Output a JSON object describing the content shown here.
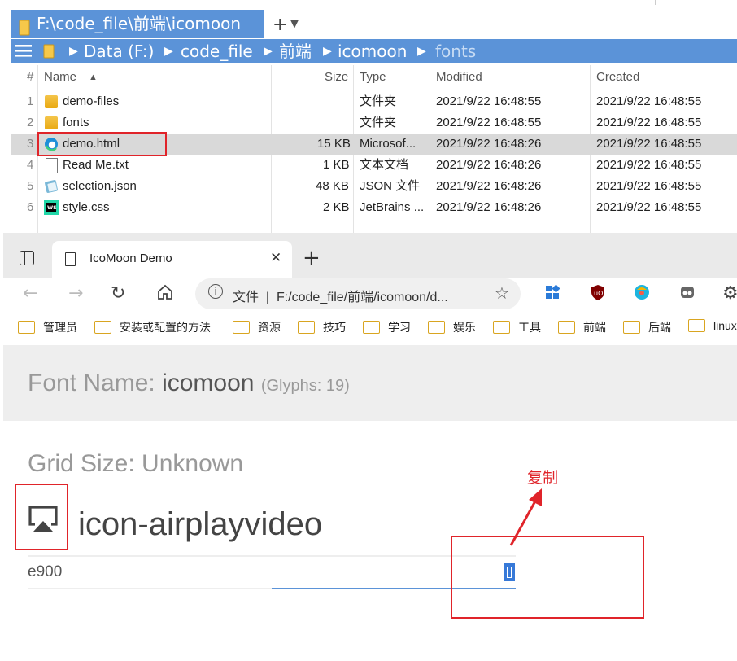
{
  "explorer": {
    "tab_title": "F:\\code_file\\前端\\icomoon",
    "path": [
      "Data (F:)",
      "code_file",
      "前端",
      "icomoon",
      "fonts"
    ],
    "columns": {
      "num": "#",
      "name": "Name",
      "size": "Size",
      "type": "Type",
      "modified": "Modified",
      "created": "Created"
    },
    "files": [
      {
        "num": "1",
        "name": "demo-files",
        "size": "",
        "type": "文件夹",
        "modified": "2021/9/22 16:48:55",
        "created": "2021/9/22 16:48:55"
      },
      {
        "num": "2",
        "name": "fonts",
        "size": "",
        "type": "文件夹",
        "modified": "2021/9/22 16:48:55",
        "created": "2021/9/22 16:48:55"
      },
      {
        "num": "3",
        "name": "demo.html",
        "size": "15 KB",
        "type": "Microsof...",
        "modified": "2021/9/22 16:48:26",
        "created": "2021/9/22 16:48:55"
      },
      {
        "num": "4",
        "name": "Read Me.txt",
        "size": "1 KB",
        "type": "文本文档",
        "modified": "2021/9/22 16:48:26",
        "created": "2021/9/22 16:48:55"
      },
      {
        "num": "5",
        "name": "selection.json",
        "size": "48 KB",
        "type": "JSON 文件",
        "modified": "2021/9/22 16:48:26",
        "created": "2021/9/22 16:48:55"
      },
      {
        "num": "6",
        "name": "style.css",
        "size": "2 KB",
        "type": "JetBrains ...",
        "modified": "2021/9/22 16:48:26",
        "created": "2021/9/22 16:48:55"
      }
    ]
  },
  "browser": {
    "tab_title": "IcoMoon Demo",
    "address_prefix": "文件",
    "address": "F:/code_file/前端/icomoon/d...",
    "bookmarks": [
      "管理员",
      "安装或配置的方法",
      "资源",
      "技巧",
      "学习",
      "娱乐",
      "工具",
      "前端",
      "后端",
      "linux"
    ]
  },
  "page": {
    "font_name_label": "Font Name:",
    "font_name": "icomoon",
    "glyphs": "(Glyphs: 19)",
    "grid_size": "Grid Size: Unknown",
    "icon_name": "icon-airplayvideo",
    "code": "e900"
  },
  "annotation": {
    "copy_label": "复制"
  },
  "colors": {
    "accent": "#5b93d8",
    "annotation_red": "#e0242a",
    "selection": "#3779d8"
  }
}
